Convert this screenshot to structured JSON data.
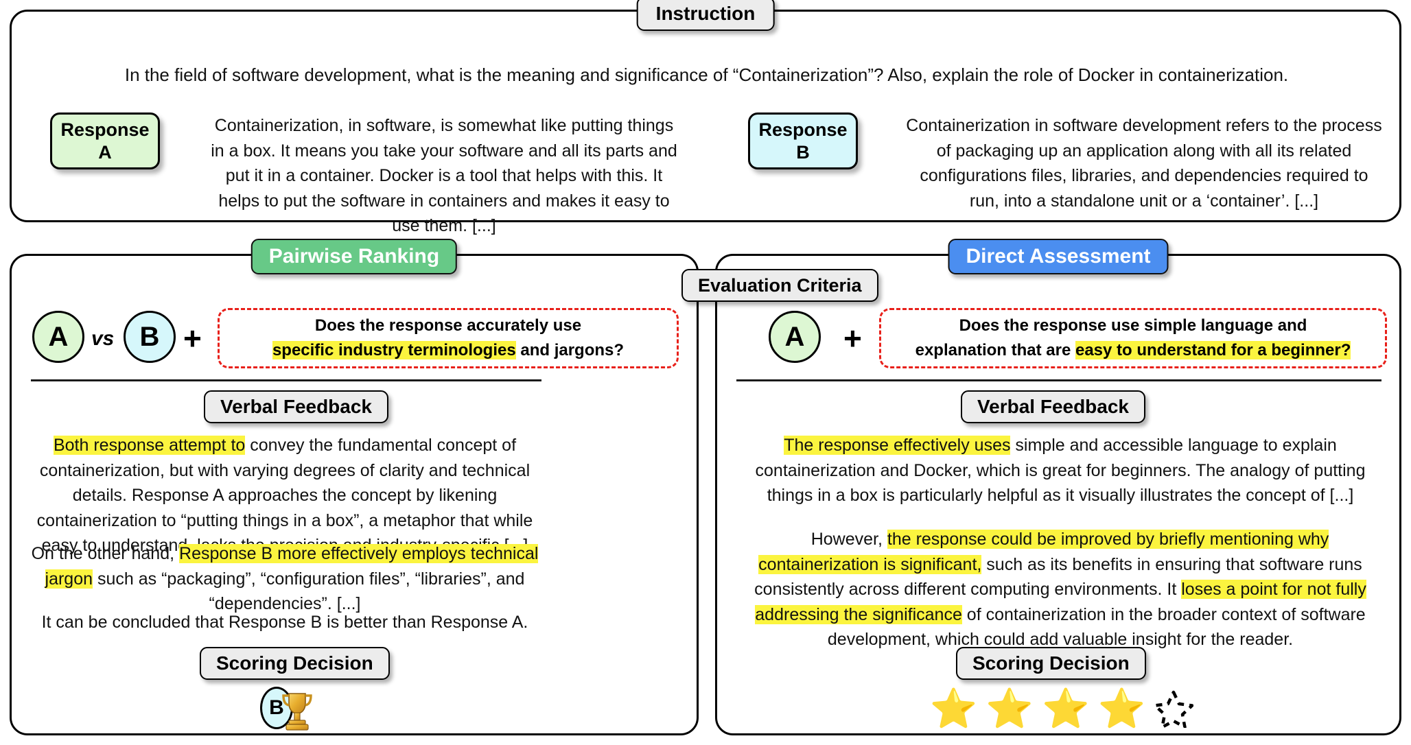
{
  "instruction_panel": {
    "badge": "Instruction",
    "instruction_text": "In the field of software development, what is the meaning and significance of “Containerization”? Also, explain the role of Docker in containerization.",
    "response_a": {
      "label_line1": "Response",
      "label_line2": "A",
      "text": "Containerization, in software, is somewhat like putting things in a box. It means you take your software and all its parts and put it in a container. Docker is a tool that helps with this. It helps to put the software in containers and makes it easy to use them. [...]",
      "color": "#ddf7d3"
    },
    "response_b": {
      "label_line1": "Response",
      "label_line2": "B",
      "text": "Containerization in software development refers to the process of packaging up an application along with all its related configurations files, libraries, and dependencies required to run, into a standalone unit or a ‘container’. [...]",
      "color": "#d6f7fb"
    }
  },
  "shared": {
    "evaluation_criteria_badge": "Evaluation Criteria",
    "verbal_feedback_badge": "Verbal Feedback",
    "scoring_decision_badge": "Scoring Decision",
    "accent_green": "#67c987",
    "accent_blue": "#4b8ef0",
    "highlight_yellow": "#fbf43f",
    "criteria_border_red": "#e8201a"
  },
  "pairwise": {
    "title": "Pairwise Ranking",
    "circle_a": "A",
    "vs": "vs",
    "circle_b": "B",
    "plus": "+",
    "criteria_line1": "Does the response accurately use",
    "criteria_hl": "specific industry terminologies",
    "criteria_tail": " and jargons?",
    "feedback": {
      "p1_hl": "Both response attempt to",
      "p1_rest": " convey the fundamental concept of containerization, but with varying degrees of clarity and technical details. Response A approaches the concept by likening containerization to “putting things in a box”, a metaphor that while easy to understand, lacks the precision and industry-specific [...]",
      "p2_pre": "On the other hand, ",
      "p2_hl": "Response B more effectively employs technical jargon",
      "p2_rest": " such as “packaging”, “configuration files”, “libraries”, and “dependencies”. [...]",
      "p3": "It can be concluded that Response B is better than Response A."
    },
    "decision": {
      "winner": "B",
      "trophy_icon": "trophy-icon"
    }
  },
  "direct": {
    "title": "Direct Assessment",
    "circle_a": "A",
    "plus": "+",
    "criteria_line1": "Does the response use simple language and",
    "criteria_line2_pre": "explanation that are ",
    "criteria_hl": "easy to understand for a beginner?",
    "feedback": {
      "p1_hl": "The response effectively uses",
      "p1_rest": " simple and accessible language to explain containerization and Docker, which is great for beginners. The analogy of putting things in a box is particularly helpful as it visually illustrates the concept of [...]",
      "p2_a": "However, ",
      "p2_hl1": "the response could be improved by briefly mentioning why containerization is significant,",
      "p2_b": " such as its benefits in ensuring that software runs consistently across different computing environments.  It ",
      "p2_hl2": "loses a point for not fully addressing the significance",
      "p2_c": " of containerization in the broader context of software development, which could add valuable insight for the reader."
    },
    "decision": {
      "stars_filled": 4,
      "stars_total": 5,
      "star_icon": "star-icon",
      "empty_star_icon": "star-outline-icon"
    }
  }
}
